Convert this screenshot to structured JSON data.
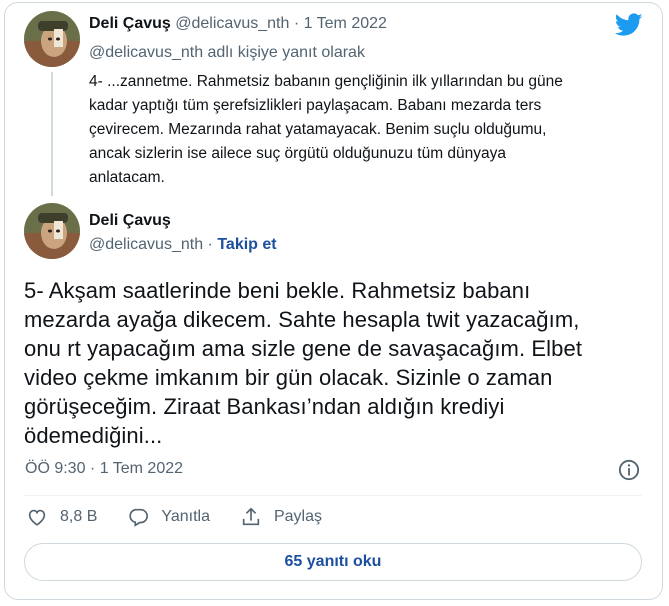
{
  "reply_tweet": {
    "author_name": "Deli Çavuş",
    "author_handle": "@delicavus_nth",
    "dot": "·",
    "date": "1 Tem 2022",
    "replying_to": "@delicavus_nth adlı kişiye yanıt olarak",
    "lines": [
      "4- ...zannetme. Rahmetsiz babanın gençliğinin ilk yıllarından bu güne",
      "kadar yaptığı tüm şerefsizlikleri paylaşacam. Babanı mezarda ters",
      "çevirecem. Mezarında rahat yatamayacak. Benim suçlu olduğumu,",
      "ancak sizlerin ise ailece suç örgütü olduğunuzu tüm dünyaya",
      "anlatacam."
    ]
  },
  "main_tweet": {
    "author_name": "Deli Çavuş",
    "author_handle": "@delicavus_nth",
    "dot": "·",
    "follow_label": "Takip et",
    "lines": [
      "5- Akşam saatlerinde beni bekle. Rahmetsiz babanı",
      "mezarda ayağa dikecem. Sahte hesapla twit yazacağım,",
      "onu rt yapacağım ama sizle gene de savaşacağım. Elbet",
      "video çekme imkanım bir gün olacak. Sizinle o zaman",
      "görüşeceğim. Ziraat Bankası’ndan aldığın krediyi",
      "ödemediğini..."
    ],
    "timestamp": "ÖÖ 9:30 · 1 Tem 2022",
    "likes_count": "8,8 B",
    "reply_label": "Yanıtla",
    "share_label": "Paylaş",
    "read_replies_label": "65 yanıtı oku"
  },
  "colors": {
    "link": "#1d4fa0",
    "twitter_blue": "#1d9bf0",
    "muted": "#536471"
  },
  "icons": [
    "twitter-bird-icon",
    "info-icon",
    "heart-icon",
    "speech-bubble-icon",
    "share-icon"
  ]
}
